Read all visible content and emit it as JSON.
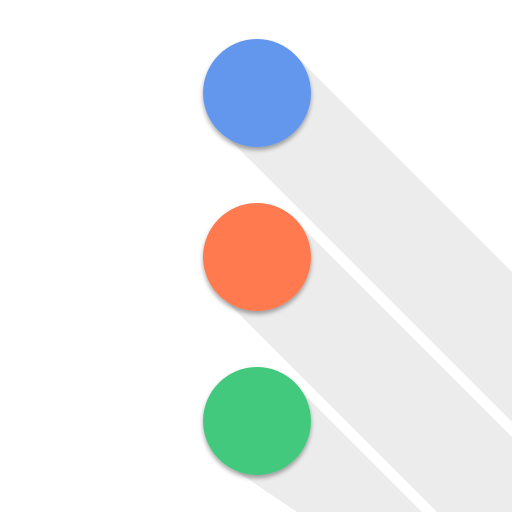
{
  "icon": {
    "name": "vertical-dots-icon",
    "background_color": "#ffffff",
    "shadow_color": "#e6e6e6",
    "dots": [
      {
        "name": "blue-dot",
        "color": "#6496ed"
      },
      {
        "name": "orange-dot",
        "color": "#ff7a4f"
      },
      {
        "name": "green-dot",
        "color": "#43c97e"
      }
    ]
  }
}
